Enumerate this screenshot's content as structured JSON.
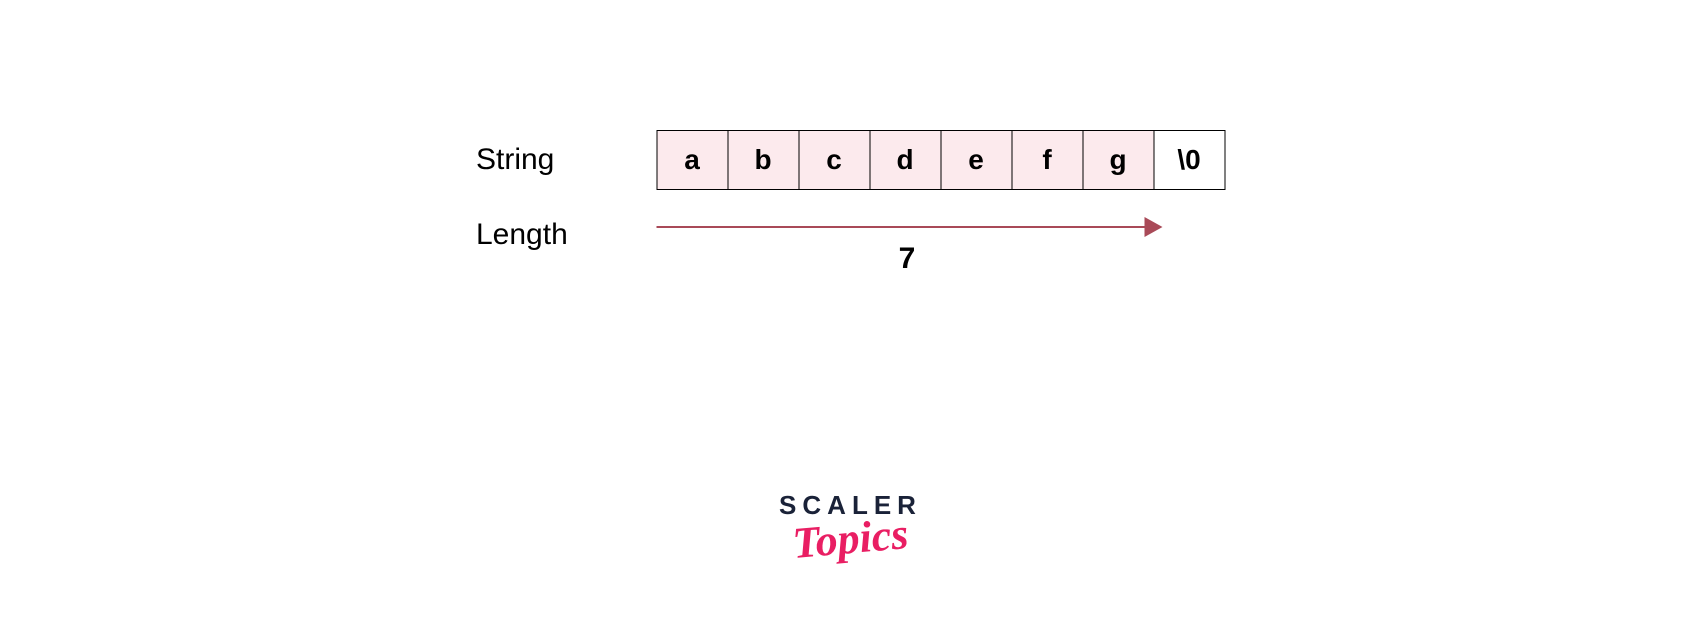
{
  "labels": {
    "string": "String",
    "length": "Length"
  },
  "cells": [
    "a",
    "b",
    "c",
    "d",
    "e",
    "f",
    "g",
    "\\0"
  ],
  "lengthValue": "7",
  "logo": {
    "top": "SCALER",
    "bottom": "Topics"
  },
  "colors": {
    "cellFill": "#fceaed",
    "arrow": "#a94a58",
    "logoDark": "#1a2238",
    "logoPink": "#e91e63"
  }
}
